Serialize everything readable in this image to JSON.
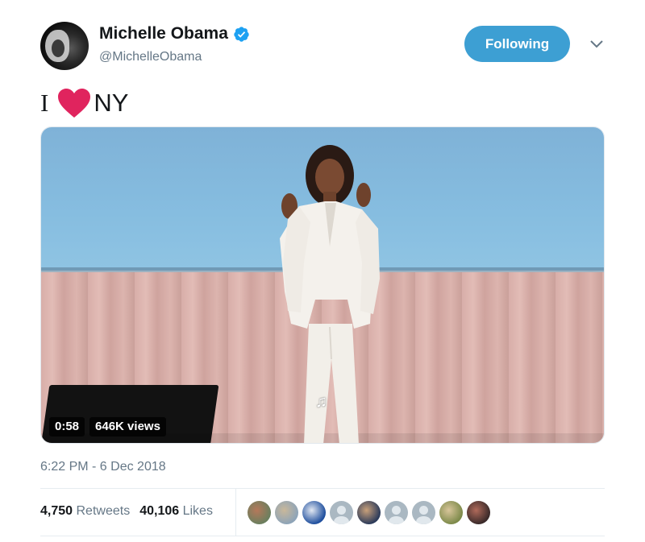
{
  "author": {
    "name": "Michelle Obama",
    "handle": "@MichelleObama",
    "verified": true
  },
  "follow_button": {
    "label": "Following",
    "color": "#3d9fd3"
  },
  "tweet": {
    "text_before": "I",
    "emoji": "red-heart-icon",
    "text_after": "NY"
  },
  "video": {
    "duration": "0:58",
    "views": "646K views"
  },
  "timestamp": "6:22 PM - 6 Dec 2018",
  "stats": {
    "retweets_count": "4,750",
    "retweets_label": "Retweets",
    "likes_count": "40,106",
    "likes_label": "Likes"
  },
  "likers": [
    {
      "type": "photo",
      "colors": [
        "#6b7f5e",
        "#b5785a"
      ]
    },
    {
      "type": "photo",
      "colors": [
        "#8ea4b8",
        "#c9b89a"
      ]
    },
    {
      "type": "photo",
      "colors": [
        "#1f4f9e",
        "#e2e8f2"
      ]
    },
    {
      "type": "default"
    },
    {
      "type": "photo",
      "colors": [
        "#2c3b5a",
        "#c9a07a"
      ]
    },
    {
      "type": "default"
    },
    {
      "type": "default"
    },
    {
      "type": "photo",
      "colors": [
        "#7d8a4a",
        "#d8c59a"
      ]
    },
    {
      "type": "photo",
      "colors": [
        "#3a2a2a",
        "#b06a5a"
      ]
    }
  ],
  "colors": {
    "accent": "#3d9fd3",
    "verified": "#1da1f2",
    "heart": "#e0245e",
    "secondary_text": "#657786"
  }
}
